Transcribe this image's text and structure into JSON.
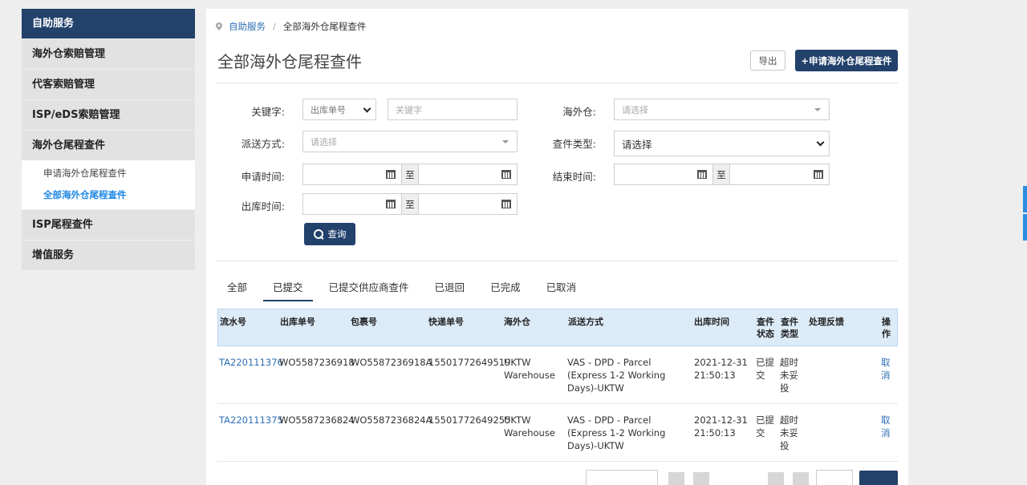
{
  "sidebar": {
    "header": "自助服务",
    "items": [
      "海外仓索赔管理",
      "代客索赔管理",
      "ISP/eDS索赔管理",
      "海外仓尾程查件"
    ],
    "sub_items": [
      {
        "label": "申请海外仓尾程查件",
        "active": false
      },
      {
        "label": "全部海外仓尾程查件",
        "active": true
      }
    ],
    "items_after": [
      "ISP尾程查件",
      "增值服务"
    ]
  },
  "breadcrumb": {
    "home": "自助服务",
    "current": "全部海外仓尾程查件"
  },
  "page_title": "全部海外仓尾程查件",
  "actions": {
    "export": "导出",
    "apply": "+申请海外仓尾程查件"
  },
  "form": {
    "keyword_label": "关键字:",
    "keyword_type": "出库单号",
    "keyword_placeholder": "关键字",
    "warehouse_label": "海外仓:",
    "warehouse_placeholder": "请选择",
    "delivery_label": "派送方式:",
    "delivery_placeholder": "请选择",
    "inquiry_type_label": "查件类型:",
    "inquiry_type_value": "请选择",
    "apply_time_label": "申请时间:",
    "end_time_label": "结束时间:",
    "outbound_time_label": "出库时间:",
    "range_sep": "至",
    "query_button": "查询"
  },
  "tabs": [
    {
      "label": "全部",
      "active": false
    },
    {
      "label": "已提交",
      "active": true
    },
    {
      "label": "已提交供应商查件",
      "active": false
    },
    {
      "label": "已退回",
      "active": false
    },
    {
      "label": "已完成",
      "active": false
    },
    {
      "label": "已取消",
      "active": false
    }
  ],
  "table": {
    "columns": [
      "流水号",
      "出库单号",
      "包裹号",
      "快递单号",
      "海外仓",
      "派送方式",
      "出库时间",
      "查件状态",
      "查件类型",
      "处理反馈",
      "操作"
    ],
    "rows": [
      {
        "serial": "TA220111376",
        "outbound_no": "WO5587236918",
        "package_no": "WO5587236918A",
        "tracking_no": "15501772649519",
        "warehouse": "UKTW Warehouse",
        "delivery": "VAS - DPD - Parcel (Express 1-2 Working Days)-UKTW",
        "outbound_time": "2021-12-31 21:50:13",
        "status": "已提交",
        "type": "超时未妥投",
        "feedback": "",
        "action": "取消"
      },
      {
        "serial": "TA220111375",
        "outbound_no": "WO5587236824",
        "package_no": "WO5587236824A",
        "tracking_no": "15501772649255",
        "warehouse": "UKTW Warehouse",
        "delivery": "VAS - DPD - Parcel (Express 1-2 Working Days)-UKTW",
        "outbound_time": "2021-12-31 21:50:13",
        "status": "已提交",
        "type": "超时未妥投",
        "feedback": "",
        "action": "取消"
      }
    ]
  },
  "colors": {
    "brand": "#22416b",
    "link": "#2e6fb4",
    "active_sub": "#1e88e5",
    "table_header": "#dcebf8"
  }
}
